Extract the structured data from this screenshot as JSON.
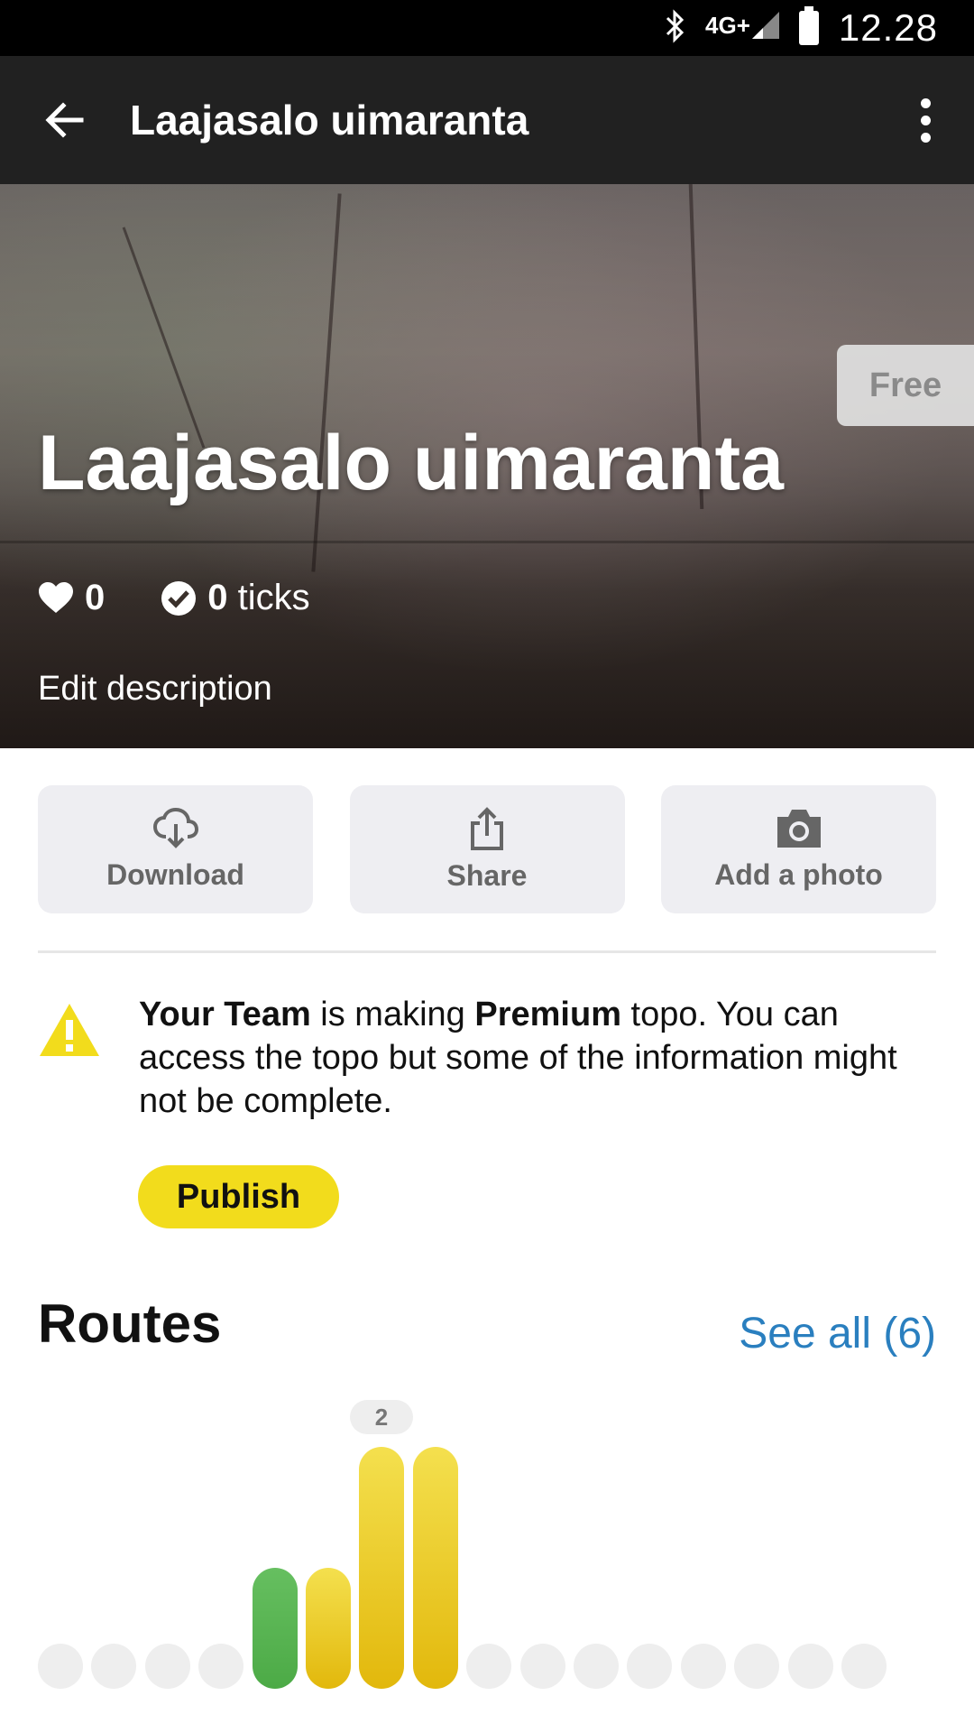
{
  "status_bar": {
    "network": "4G+",
    "time": "12.28"
  },
  "app_bar": {
    "title": "Laajasalo uimaranta"
  },
  "hero": {
    "badge": "Free",
    "title": "Laajasalo uimaranta",
    "likes": "0",
    "ticks_count": "0",
    "ticks_label": "ticks",
    "edit_description": "Edit description"
  },
  "actions": [
    {
      "label": "Download",
      "icon": "cloud-download-icon"
    },
    {
      "label": "Share",
      "icon": "share-icon"
    },
    {
      "label": "Add a photo",
      "icon": "camera-icon"
    }
  ],
  "notice": {
    "team": "Your Team",
    "part1": " is making ",
    "premium": "Premium",
    "part2": " topo. You can access the topo but some of the information might not be complete.",
    "publish_label": "Publish"
  },
  "routes": {
    "title": "Routes",
    "see_all": "See all (6)"
  },
  "chart_data": {
    "type": "bar",
    "values": [
      0,
      0,
      0,
      0,
      1,
      1,
      2,
      2,
      0,
      0,
      0,
      0,
      0,
      0,
      0,
      0
    ],
    "value_label": "2",
    "colors": [
      "#eeeeee",
      "#eeeeee",
      "#eeeeee",
      "#eeeeee",
      "#5cb85c",
      "#e6be16",
      "#e6be16",
      "#e6be16",
      "#eeeeee",
      "#eeeeee",
      "#eeeeee",
      "#eeeeee",
      "#eeeeee",
      "#eeeeee",
      "#eeeeee",
      "#eeeeee"
    ]
  },
  "colors": {
    "accent_yellow": "#f2dc1c",
    "link_blue": "#2a7fbf",
    "app_bar": "#212121"
  }
}
